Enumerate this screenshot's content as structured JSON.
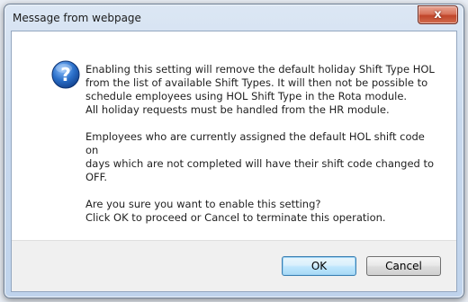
{
  "window": {
    "title": "Message from webpage",
    "close_glyph": "x"
  },
  "dialog": {
    "icon": "question-icon",
    "paragraphs": [
      "Enabling this setting will remove the default holiday Shift Type HOL\nfrom the list of available Shift Types. It will then not be possible to\nschedule employees using HOL Shift Type in the Rota module.\nAll holiday requests must be handled from the HR module.",
      "Employees who are currently assigned the default HOL shift code on\ndays which are not completed will have their shift code changed to\nOFF.",
      "Are you sure you want to enable this setting?\nClick OK to proceed or Cancel to terminate this operation."
    ]
  },
  "buttons": {
    "ok_label": "OK",
    "cancel_label": "Cancel"
  },
  "colors": {
    "accent": "#3c7fb1",
    "close": "#c0452a",
    "icon_blue": "#2a6fc9"
  }
}
